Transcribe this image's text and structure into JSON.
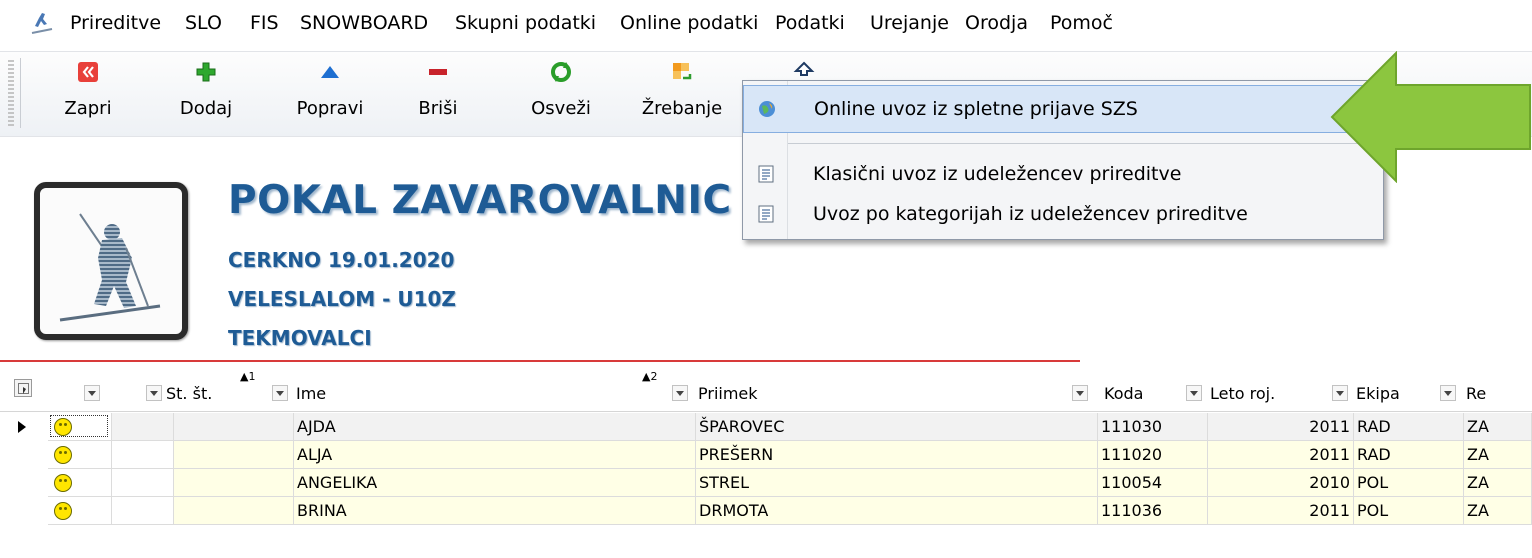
{
  "menu": [
    "Prireditve",
    "SLO",
    "FIS",
    "SNOWBOARD",
    "Skupni podatki",
    "Online podatki",
    "Podatki",
    "Urejanje",
    "Orodja",
    "Pomoč"
  ],
  "toolbar": {
    "buttons": [
      {
        "label": "Zapri",
        "icon": "close-red-icon"
      },
      {
        "label": "Dodaj",
        "icon": "plus-green-icon"
      },
      {
        "label": "Popravi",
        "icon": "triangle-up-blue-icon"
      },
      {
        "label": "Briši",
        "icon": "minus-red-icon"
      },
      {
        "label": "Osveži",
        "icon": "refresh-green-icon"
      },
      {
        "label": "Žrebanje",
        "icon": "draw-icon"
      },
      {
        "label": "",
        "icon": "import-icon"
      }
    ]
  },
  "header": {
    "title": "POKAL ZAVAROVALNIC",
    "location_date": "CERKNO  19.01.2020",
    "discipline": "VELESLALOM - U10Z",
    "section": "TEKMOVALCI"
  },
  "dropdown": {
    "items": [
      {
        "label": "Online uvoz iz spletne prijave SZS",
        "icon": "globe-icon",
        "highlighted": true
      },
      {
        "label": "Klasični uvoz iz udeležencev prireditve",
        "icon": "document-icon",
        "highlighted": false
      },
      {
        "label": "Uvoz po kategorijah iz udeležencev prireditve",
        "icon": "document-icon",
        "highlighted": false
      }
    ]
  },
  "grid": {
    "columns": [
      "St. št.",
      "Ime",
      "Priimek",
      "Koda",
      "Leto roj.",
      "Ekipa",
      "Re"
    ],
    "sort_marks": [
      "▲1",
      "▲2"
    ],
    "rows": [
      {
        "ime": "AJDA",
        "priimek": "ŠPAROVEC",
        "koda": "111030",
        "leto": "2011",
        "ekipa": "RAD",
        "re": "ZA"
      },
      {
        "ime": "ALJA",
        "priimek": "PREŠERN",
        "koda": "111020",
        "leto": "2011",
        "ekipa": "RAD",
        "re": "ZA"
      },
      {
        "ime": "ANGELIKA",
        "priimek": "STREL",
        "koda": "110054",
        "leto": "2010",
        "ekipa": "POL",
        "re": "ZA"
      },
      {
        "ime": "BRINA",
        "priimek": "DRMOTA",
        "koda": "111036",
        "leto": "2011",
        "ekipa": "POL",
        "re": "ZA"
      }
    ]
  },
  "colors": {
    "title": "#1e5b95",
    "arrow": "#8cc63f",
    "highlight": "#d8e6f7",
    "cell_yellow": "#ffffe6"
  }
}
